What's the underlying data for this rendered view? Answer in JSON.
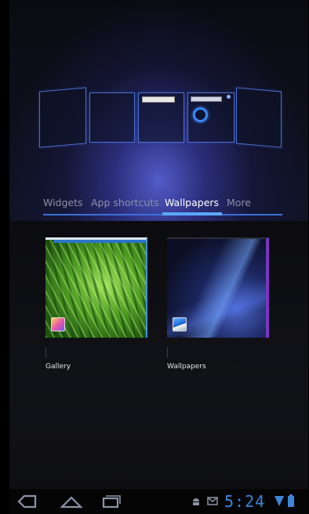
{
  "tabs": [
    {
      "label": "Widgets",
      "selected": false
    },
    {
      "label": "App shortcuts",
      "selected": false
    },
    {
      "label": "Wallpapers",
      "selected": true
    },
    {
      "label": "More",
      "selected": false
    }
  ],
  "tiles": [
    {
      "label": "Gallery",
      "icon": "gallery-icon"
    },
    {
      "label": "Wallpapers",
      "icon": "wallpaper-icon"
    }
  ],
  "status_bar": {
    "time": "5:24"
  },
  "colors": {
    "accent": "#3c6fd8",
    "clock": "#3d85d8"
  }
}
